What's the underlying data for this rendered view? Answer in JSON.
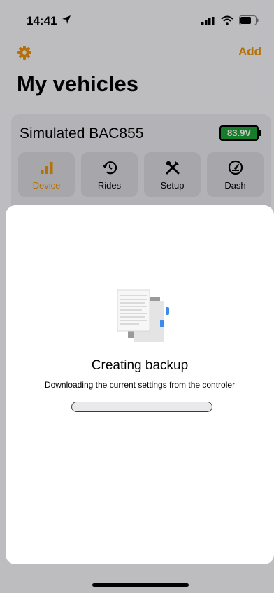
{
  "status_bar": {
    "time": "14:41"
  },
  "nav": {
    "add_label": "Add"
  },
  "page": {
    "title": "My vehicles"
  },
  "vehicle": {
    "name": "Simulated BAC855",
    "battery": "83.9V",
    "battery_color": "#1ea035",
    "actions": [
      {
        "label": "Device",
        "icon": "bar-chart-icon",
        "active": true
      },
      {
        "label": "Rides",
        "icon": "history-icon",
        "active": false
      },
      {
        "label": "Setup",
        "icon": "tools-icon",
        "active": false
      },
      {
        "label": "Dash",
        "icon": "gauge-icon",
        "active": false
      }
    ]
  },
  "sheet": {
    "title": "Creating backup",
    "subtitle": "Downloading the current settings from the controler",
    "progress": 0
  },
  "colors": {
    "accent": "#e8900a"
  }
}
